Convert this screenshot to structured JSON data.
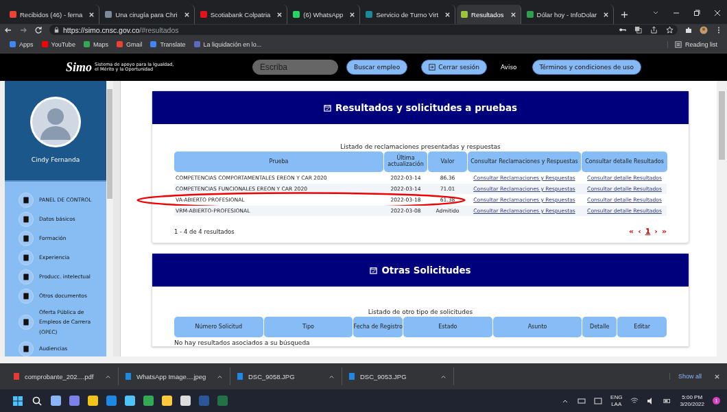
{
  "browser": {
    "tabs": [
      {
        "title": "Recibidos (46) - ferna",
        "selected": false,
        "color": "#ea4335"
      },
      {
        "title": "Una cirugía para Chri",
        "selected": false,
        "color": "#7a8a99"
      },
      {
        "title": "Scotiabank Colpatria",
        "selected": false,
        "color": "#e0141e"
      },
      {
        "title": "(6) WhatsApp",
        "selected": false,
        "color": "#25d366"
      },
      {
        "title": "Servicio de Turno Virt",
        "selected": false,
        "color": "#1a8a9a"
      },
      {
        "title": "Resultados",
        "selected": true,
        "color": "#9bc53d"
      },
      {
        "title": "Dólar hoy - InfoDolar",
        "selected": false,
        "color": "#2e9e4f"
      }
    ],
    "address": {
      "host": "https://simo.cnsc.gov.co",
      "path": "/#resultados"
    },
    "bookmarks": [
      {
        "label": "Apps",
        "color": "#4285f4"
      },
      {
        "label": "YouTube",
        "color": "#ff0000"
      },
      {
        "label": "Maps",
        "color": "#34a853"
      },
      {
        "label": "Gmail",
        "color": "#ea4335"
      },
      {
        "label": "Translate",
        "color": "#4285f4"
      },
      {
        "label": "La liquidación en lo...",
        "color": "#5c6bc0"
      }
    ],
    "reading_list": "Reading list"
  },
  "site_header": {
    "logo": "Simo",
    "tagline": "Sistema de apoyo para la Igualdad, el Mérito y la Oportunidad",
    "search": {
      "placeholder": "Escriba"
    },
    "search_button": "Buscar empleo",
    "logout_button": "Cerrar sesión",
    "notice_link": "Aviso",
    "terms_button": "Términos y condiciones de uso"
  },
  "sidebar": {
    "user_name": "Cindy Fernanda",
    "items": [
      {
        "label": "PANEL DE CONTROL"
      },
      {
        "label": "Datos básicos"
      },
      {
        "label": "Formación"
      },
      {
        "label": "Experiencia"
      },
      {
        "label": "Producc. intelectual"
      },
      {
        "label": "Otros documentos"
      },
      {
        "label": "Oferta Pública de Empleos de Carrera (OPEC)"
      },
      {
        "label": "Audiencias"
      }
    ]
  },
  "results": {
    "title": "Resultados y solicitudes a pruebas",
    "caption": "Listado de reclamaciones presentadas y respuestas",
    "columns": [
      "Prueba",
      "Última actualización",
      "Valor",
      "Consultar Reclamaciones y Respuestas",
      "Consultar detalle Resultados"
    ],
    "rows": [
      {
        "prueba": "COMPETENCIAS COMPORTAMENTALES EREON Y CAR 2020",
        "fecha": "2022-03-14",
        "valor": "86.36",
        "reclamaciones": "Consultar Reclamaciones y Respuestas",
        "detalle": "Consultar detalle Resultados",
        "circled": false
      },
      {
        "prueba": "COMPETENCIAS FUNCIONALES EREON Y CAR 2020",
        "fecha": "2022-03-14",
        "valor": "71.01",
        "reclamaciones": "Consultar Reclamaciones y Respuestas",
        "detalle": "Consultar detalle Resultados",
        "circled": false
      },
      {
        "prueba": "VA-ABIERTO PROFESIONAL",
        "fecha": "2022-03-18",
        "valor": "61.38",
        "reclamaciones": "Consultar Reclamaciones y Respuestas",
        "detalle": "Consultar detalle Resultados",
        "circled": true
      },
      {
        "prueba": "VRM-ABIERTO-PROFESIONAL",
        "fecha": "2022-03-08",
        "valor": "Admitido",
        "reclamaciones": "Consultar Reclamaciones y Respuestas",
        "detalle": "Consultar detalle Resultados",
        "circled": false
      }
    ],
    "count": "1 - 4 de 4 resultados",
    "pagination": {
      "first": "«",
      "prev": "‹",
      "page": "1",
      "next": "›",
      "last": "»"
    }
  },
  "other": {
    "title": "Otras Solicitudes",
    "caption": "Listado de otro tipo de solicitudes",
    "columns": [
      "Número Solicitud",
      "Tipo",
      "Fecha de Registro",
      "Estado",
      "Asunto",
      "Detalle",
      "Editar"
    ],
    "empty": "No hay resultados asociados a su búsqueda"
  },
  "downloads": {
    "items": [
      {
        "name": "comprobante_202....pdf",
        "color": "#e53935"
      },
      {
        "name": "WhatsApp Image....jpeg",
        "color": "#1e88e5"
      },
      {
        "name": "DSC_9058.JPG",
        "color": "#1e88e5"
      },
      {
        "name": "DSC_9053.JPG",
        "color": "#1e88e5"
      }
    ],
    "show_all": "Show all"
  },
  "taskbar": {
    "apps": [
      {
        "color": "#8ab4f8"
      },
      {
        "color": "#7b83eb"
      },
      {
        "color": "#f0c419"
      },
      {
        "color": "#1e88e5"
      },
      {
        "color": "#4fc3f7"
      },
      {
        "color": "#34a853"
      },
      {
        "color": "#ffc83d"
      },
      {
        "color": "#dddddd"
      },
      {
        "color": "#2b579a"
      },
      {
        "color": "#217346"
      }
    ],
    "language": "ENG",
    "layout": "LAA",
    "time": "5:00 PM",
    "date": "3/20/2022",
    "notifications": "1"
  }
}
